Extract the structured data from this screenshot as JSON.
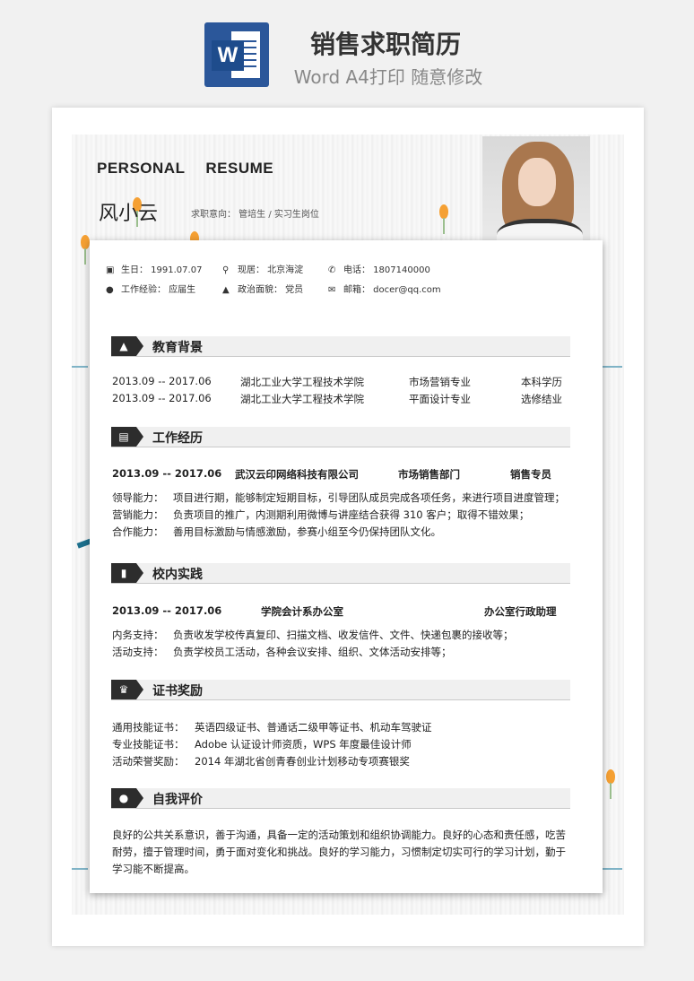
{
  "banner": {
    "title": "销售求职简历",
    "subtitle": "Word A4打印 随意修改",
    "icon": "word-icon"
  },
  "header": {
    "personal": "PERSONAL",
    "resume": "RESUME",
    "name": "风小云",
    "intent": "求职意向：  管培生  /  实习生岗位"
  },
  "info": {
    "birth": "生日：  1991.07.07",
    "location": "现居：  北京海淀",
    "phone": "电话：  1807140000",
    "experience": "工作经验：  应届生",
    "politics": "政治面貌：  党员",
    "email": "邮箱：  docer@qq.com"
  },
  "education": {
    "title": "教育背景",
    "rows": [
      {
        "date": "2013.09 -- 2017.06",
        "school": "湖北工业大学工程技术学院",
        "major": "市场营销专业",
        "degree": "本科学历"
      },
      {
        "date": "2013.09 -- 2017.06",
        "school": "湖北工业大学工程技术学院",
        "major": "平面设计专业",
        "degree": "选修结业"
      }
    ]
  },
  "work": {
    "title": "工作经历",
    "date": "2013.09 -- 2017.06",
    "company": "武汉云印网络科技有限公司",
    "dept": "市场销售部门",
    "position": "销售专员",
    "lines": [
      {
        "label": "领导能力：",
        "text": "项目进行期，能够制定短期目标，引导团队成员完成各项任务，来进行项目进度管理；"
      },
      {
        "label": "营销能力：",
        "text": "负责项目的推广，内测期利用微博与讲座结合获得 310 客户；取得不错效果；"
      },
      {
        "label": "合作能力：",
        "text": "善用目标激励与情感激励，参赛小组至今仍保持团队文化。"
      }
    ]
  },
  "campus": {
    "title": "校内实践",
    "date": "2013.09 -- 2017.06",
    "org": "学院会计系办公室",
    "role": "办公室行政助理",
    "lines": [
      {
        "label": "内务支持：",
        "text": "负责收发学校传真复印、扫描文档、收发信件、文件、快递包裹的接收等；"
      },
      {
        "label": "活动支持：",
        "text": "负责学校员工活动，各种会议安排、组织、文体活动安排等；"
      }
    ]
  },
  "certs": {
    "title": "证书奖励",
    "lines": [
      {
        "label": "通用技能证书：",
        "text": "英语四级证书、普通话二级甲等证书、机动车驾驶证"
      },
      {
        "label": "专业技能证书：",
        "text": "Adobe 认证设计师资质，WPS 年度最佳设计师"
      },
      {
        "label": "活动荣誉奖励：",
        "text": "2014 年湖北省创青春创业计划移动专项赛银奖"
      }
    ]
  },
  "self": {
    "title": "自我评价",
    "text": "良好的公共关系意识，善于沟通，具备一定的活动策划和组织协调能力。良好的心态和责任感，吃苦耐劳，擅于管理时间，勇于面对变化和挑战。良好的学习能力，习惯制定切实可行的学习计划，勤于学习能不断提高。"
  },
  "colors": {
    "dark": "#2d2d2d",
    "accent_blue": "#1c6f8c",
    "tulip": "#f5a033"
  }
}
